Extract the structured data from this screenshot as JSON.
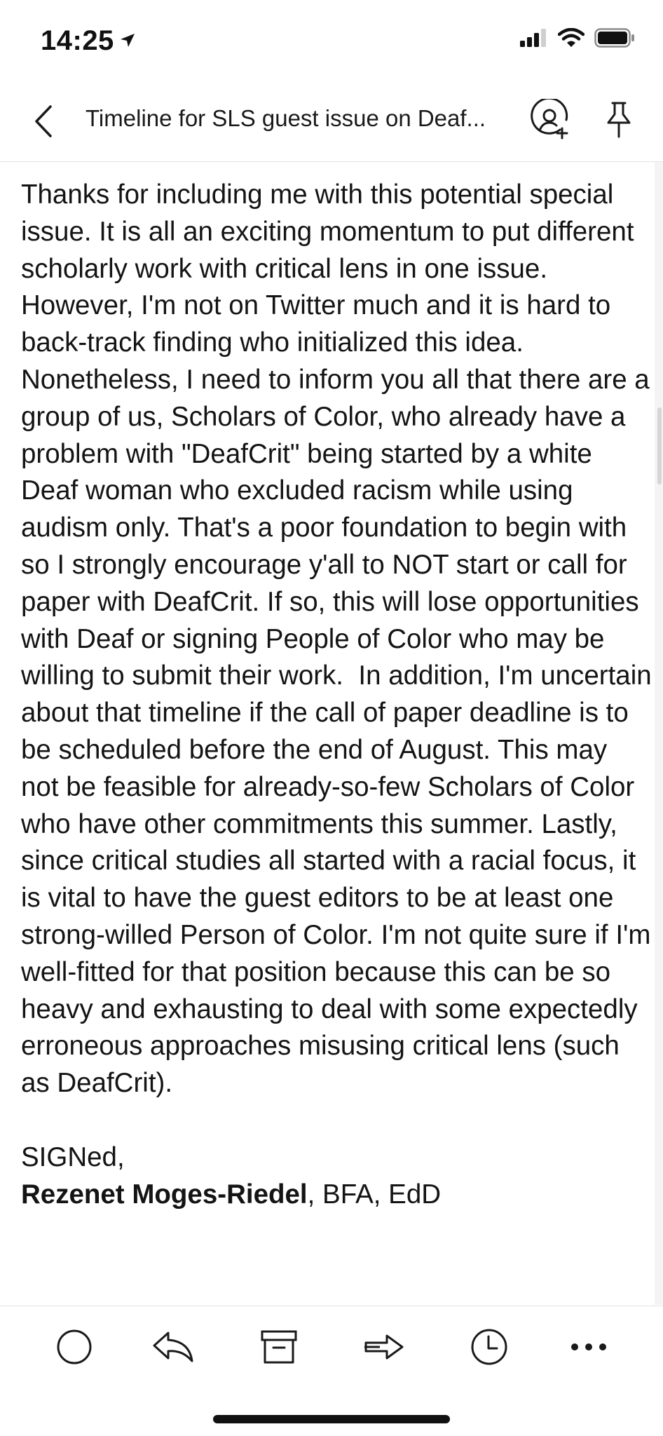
{
  "status_bar": {
    "time": "14:25",
    "icons": [
      "location-arrow-icon",
      "cellular-signal-icon",
      "wifi-icon",
      "battery-icon"
    ]
  },
  "header": {
    "back_icon": "chevron-left-icon",
    "title": "Timeline for SLS guest issue on Deaf...",
    "add_person_icon": "add-person-icon",
    "pin_icon": "pin-icon"
  },
  "message": {
    "paragraphs": [
      "Thanks for including me with this potential special issue. It is all an exciting momentum to put different scholarly work with critical lens in one issue. However, I'm not on Twitter much and it is hard to back-track finding who initialized this idea. Nonetheless, I need to inform you all that there are a group of us, Scholars of Color, who already have a problem with \"DeafCrit\" being started by a white Deaf woman who excluded racism while using audism only. That's a poor foundation to begin with so I strongly encourage y'all to NOT start or call for paper with DeafCrit. If so, this will lose opportunities with Deaf or signing People of Color who may be willing to submit their work.  In addition, I'm uncertain about that timeline if the call of paper deadline is to be scheduled before the end of August. This may not be feasible for already-so-few Scholars of Color who have other commitments this summer. Lastly, since critical studies all started with a racial focus, it is vital to have the guest editors to be at least one strong-willed Person of Color. I'm not quite sure if I'm well-fitted for that position because this can be so heavy and exhausting to deal with some expectedly erroneous approaches misusing critical lens (such as DeafCrit)."
    ],
    "sign_off": "SIGNed,",
    "signature_name": "Rezenet Moges-Riedel",
    "signature_credentials": ", BFA, EdD"
  },
  "toolbar": {
    "items": [
      {
        "name": "mark-unread-button",
        "icon": "circle-icon"
      },
      {
        "name": "reply-button",
        "icon": "reply-icon"
      },
      {
        "name": "archive-button",
        "icon": "archive-icon"
      },
      {
        "name": "forward-button",
        "icon": "forward-icon"
      },
      {
        "name": "snooze-button",
        "icon": "clock-icon"
      },
      {
        "name": "more-button",
        "icon": "more-dots-icon"
      }
    ]
  },
  "colors": {
    "text": "#141414",
    "icon": "#1a1a1a",
    "divider": "#e3e3e3",
    "background": "#ffffff"
  }
}
